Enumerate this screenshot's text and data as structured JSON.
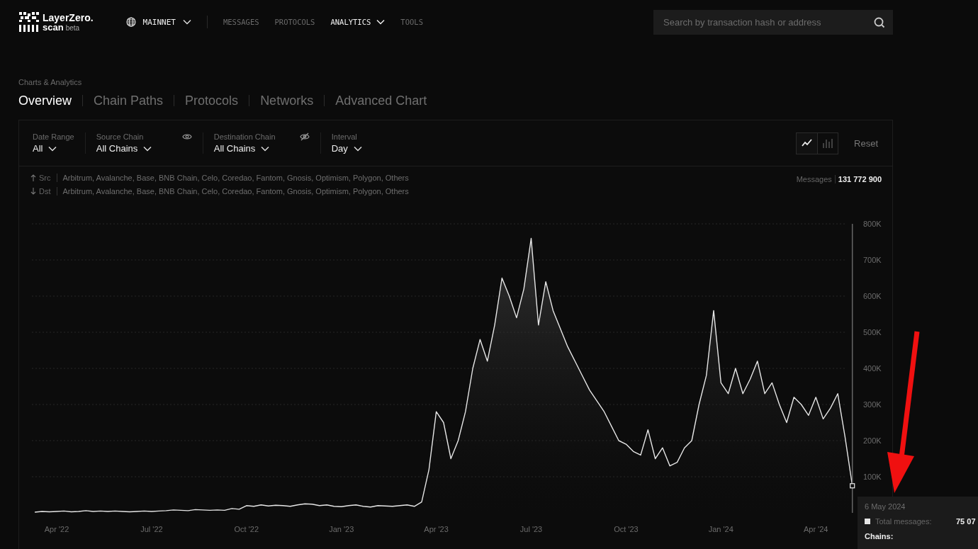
{
  "logo": {
    "name": "LayerZero.",
    "product": "scan",
    "tag": "beta"
  },
  "network": {
    "label": "MAINNET"
  },
  "nav": [
    {
      "label": "MESSAGES",
      "selected": false,
      "dropdown": false
    },
    {
      "label": "PROTOCOLS",
      "selected": false,
      "dropdown": false
    },
    {
      "label": "ANALYTICS",
      "selected": true,
      "dropdown": true
    },
    {
      "label": "TOOLS",
      "selected": false,
      "dropdown": false
    }
  ],
  "search": {
    "placeholder": "Search by transaction hash or address"
  },
  "breadcrumb": "Charts & Analytics",
  "tabs": [
    {
      "label": "Overview",
      "selected": true
    },
    {
      "label": "Chain Paths",
      "selected": false
    },
    {
      "label": "Protocols",
      "selected": false
    },
    {
      "label": "Networks",
      "selected": false
    },
    {
      "label": "Advanced Chart",
      "selected": false
    }
  ],
  "filters": [
    {
      "label": "Date Range",
      "value": "All",
      "kind": "plain"
    },
    {
      "label": "Source Chain",
      "value": "All Chains",
      "kind": "eye"
    },
    {
      "label": "Destination Chain",
      "value": "All Chains",
      "kind": "eye-off"
    },
    {
      "label": "Interval",
      "value": "Day",
      "kind": "plain"
    }
  ],
  "chart_types": [
    {
      "kind": "line",
      "selected": true
    },
    {
      "kind": "bar",
      "selected": false
    }
  ],
  "reset": "Reset",
  "chains": [
    {
      "kind": "up",
      "label": "Src",
      "list": "Arbitrum, Avalanche, Base, BNB Chain, Celo, Coredao, Fantom, Gnosis, Optimism, Polygon, Others"
    },
    {
      "kind": "down",
      "label": "Dst",
      "list": "Arbitrum, Avalanche, Base, BNB Chain, Celo, Coredao, Fantom, Gnosis, Optimism, Polygon, Others"
    }
  ],
  "total": {
    "label": "Messages",
    "value": "131 772 900"
  },
  "chart_data": {
    "type": "area",
    "ylim": [
      0,
      800
    ],
    "grid": true,
    "categories": [
      null,
      null,
      null,
      "Apr '22",
      null,
      null,
      null,
      null,
      null,
      null,
      null,
      null,
      null,
      null,
      null,
      null,
      "Jul '22",
      null,
      null,
      null,
      null,
      null,
      null,
      null,
      null,
      null,
      null,
      null,
      null,
      "Oct '22",
      null,
      null,
      null,
      null,
      null,
      null,
      null,
      null,
      null,
      null,
      null,
      null,
      "Jan '23",
      null,
      null,
      null,
      null,
      null,
      null,
      null,
      null,
      null,
      null,
      null,
      null,
      "Apr '23",
      null,
      null,
      null,
      null,
      null,
      null,
      null,
      null,
      null,
      null,
      null,
      null,
      "Jul '23",
      null,
      null,
      null,
      null,
      null,
      null,
      null,
      null,
      null,
      null,
      null,
      null,
      "Oct '23",
      null,
      null,
      null,
      null,
      null,
      null,
      null,
      null,
      null,
      null,
      null,
      null,
      "Jan '24",
      null,
      null,
      null,
      null,
      null,
      null,
      null,
      null,
      null,
      null,
      null,
      null,
      "Apr '24",
      null,
      null,
      null,
      null,
      null
    ],
    "yticks": [
      {
        "value": 100,
        "label": "100K"
      },
      {
        "value": 200,
        "label": "200K"
      },
      {
        "value": 300,
        "label": "300K"
      },
      {
        "value": 400,
        "label": "400K"
      },
      {
        "value": 500,
        "label": "500K"
      },
      {
        "value": 600,
        "label": "600K"
      },
      {
        "value": 700,
        "label": "700K"
      },
      {
        "value": 800,
        "label": "800K"
      }
    ],
    "series": [
      {
        "color": "#e6e6e6",
        "values": [
          2,
          4,
          3,
          4,
          5,
          3,
          4,
          6,
          4,
          5,
          4,
          5,
          4,
          3,
          4,
          5,
          4,
          5,
          6,
          8,
          7,
          6,
          9,
          8,
          7,
          8,
          7,
          12,
          10,
          20,
          18,
          22,
          19,
          21,
          20,
          18,
          22,
          25,
          24,
          20,
          22,
          18,
          17,
          20,
          22,
          18,
          16,
          20,
          19,
          18,
          20,
          22,
          18,
          30,
          120,
          280,
          250,
          150,
          200,
          280,
          400,
          480,
          420,
          520,
          650,
          600,
          540,
          620,
          760,
          520,
          640,
          560,
          510,
          460,
          420,
          380,
          340,
          310,
          280,
          240,
          200,
          190,
          170,
          160,
          230,
          150,
          180,
          130,
          140,
          180,
          200,
          300,
          380,
          560,
          360,
          330,
          400,
          330,
          370,
          420,
          330,
          360,
          300,
          250,
          320,
          300,
          270,
          320,
          260,
          290,
          330,
          210,
          75
        ]
      }
    ]
  },
  "tooltip": {
    "date": "6 May 2024",
    "label": "Total messages:",
    "value": "75 07",
    "chains_label": "Chains:"
  }
}
